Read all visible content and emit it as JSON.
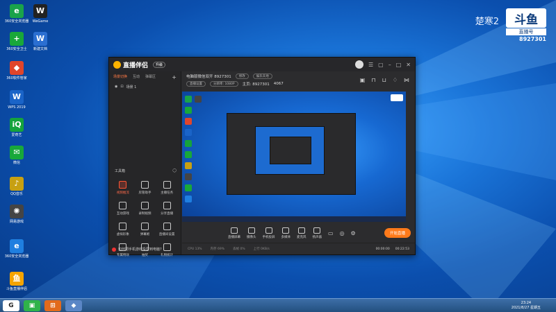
{
  "watermark": {
    "stream_title": "楚寒2",
    "logo": "斗鱼",
    "tag": "直播号",
    "room_no": "8927301"
  },
  "desktop_icons": [
    {
      "label": "360安全浏览器",
      "glyph": "e",
      "color": "#1aa34a"
    },
    {
      "label": "WeGame",
      "glyph": "W",
      "color": "#222"
    },
    {
      "label": "360安全卫士",
      "glyph": "+",
      "color": "#19a83a"
    },
    {
      "label": "新建文档",
      "glyph": "W",
      "color": "#2b6fd1"
    },
    {
      "label": "360软件管家",
      "glyph": "◆",
      "color": "#e0452b"
    },
    {
      "label": "WPS 2019",
      "glyph": "W",
      "color": "#1a64c8"
    },
    {
      "label": "爱奇艺",
      "glyph": "iQ",
      "color": "#15a33c"
    },
    {
      "label": "微信",
      "glyph": "✉",
      "color": "#18a83a"
    },
    {
      "label": "QQ音乐",
      "glyph": "♪",
      "color": "#c7a012"
    },
    {
      "label": "网易游戏",
      "glyph": "✺",
      "color": "#444"
    },
    {
      "label": "360安全卫士",
      "glyph": "+",
      "color": "#19a83a"
    },
    {
      "label": "360安全浏览器",
      "glyph": "e",
      "color": "#1f7fe0"
    },
    {
      "label": "斗鱼直播伴侣",
      "glyph": "鱼",
      "color": "#f5a400"
    }
  ],
  "app": {
    "brand": "直播伴侣",
    "badge": "升级",
    "tabs": [
      "场景切换",
      "互动",
      "弹幕区"
    ],
    "tab_plus": "+",
    "scene_label": "场景 1",
    "tools_title": "工具箱",
    "tools": [
      {
        "label": "视频推流",
        "red": true
      },
      {
        "label": "房管助手",
        "red": false
      },
      {
        "label": "主播任务",
        "red": false
      },
      {
        "label": "互动游戏",
        "red": false
      },
      {
        "label": "录制视频",
        "red": false
      },
      {
        "label": "分享直播",
        "red": false
      },
      {
        "label": "虚拟形象",
        "red": false
      },
      {
        "label": "弹幕姬",
        "red": false
      },
      {
        "label": "直播间设置",
        "red": false
      },
      {
        "label": "专属特效",
        "red": false
      },
      {
        "label": "抽奖",
        "red": false
      },
      {
        "label": "礼物统计",
        "red": false
      }
    ],
    "notice": "如何把手机游戏投屏到电脑?",
    "room_title": "电脑版微信双开 8927301",
    "edit_btn": "修改",
    "category": "娱乐天地",
    "row2_items": [
      "直播设置",
      "分辨率: 1080P",
      "主页: 8927301",
      "4067"
    ],
    "controls": [
      "直播屏幕",
      "摄像头",
      "手机投屏",
      "多媒体",
      "麦克风",
      "扬声器"
    ],
    "go_live": "开始直播",
    "status": [
      "CPU 13%",
      "内存 69%",
      "丢帧 0%",
      "上行 0KB/s"
    ],
    "live_time": "00:00:00",
    "clock": "00:22:53"
  },
  "taskbar": {
    "time": "23:24",
    "date": "2021/8/27 星期五"
  }
}
